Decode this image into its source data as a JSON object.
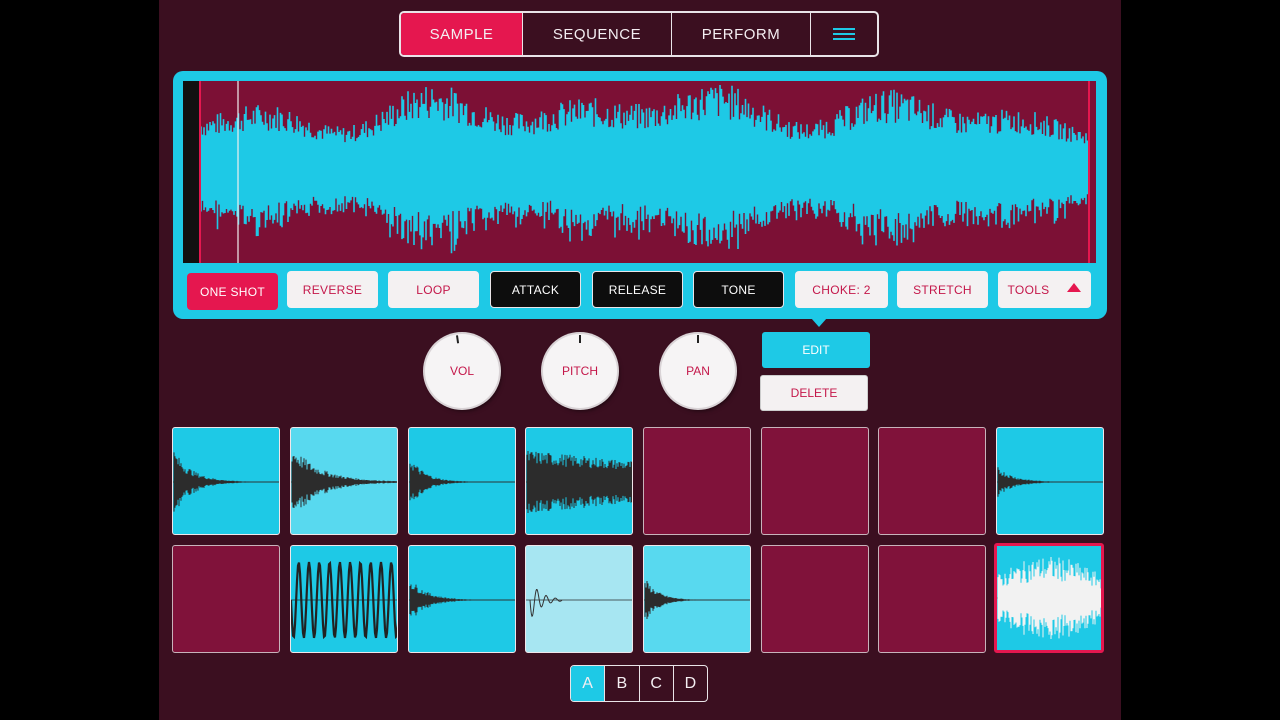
{
  "tabs": [
    {
      "label": "SAMPLE",
      "active": true
    },
    {
      "label": "SEQUENCE",
      "active": false
    },
    {
      "label": "PERFORM",
      "active": false
    }
  ],
  "menu_icon": "hamburger-menu-icon",
  "sample_buttons": {
    "one_shot": "ONE SHOT",
    "reverse": "REVERSE",
    "loop": "LOOP",
    "attack": "ATTACK",
    "release": "RELEASE",
    "tone": "TONE",
    "choke": "CHOKE: 2",
    "stretch": "STRETCH",
    "tools": "TOOLS"
  },
  "context_menu": {
    "edit": "EDIT",
    "delete": "DELETE"
  },
  "knobs": [
    {
      "label": "VOL"
    },
    {
      "label": "PITCH"
    },
    {
      "label": "PAN"
    }
  ],
  "banks": [
    "A",
    "B",
    "C",
    "D"
  ],
  "active_bank": "A",
  "colors": {
    "background": "#3b0f20",
    "accent_red": "#e5174f",
    "accent_cyan": "#1ec9e6",
    "pad_empty": "#80123a"
  }
}
